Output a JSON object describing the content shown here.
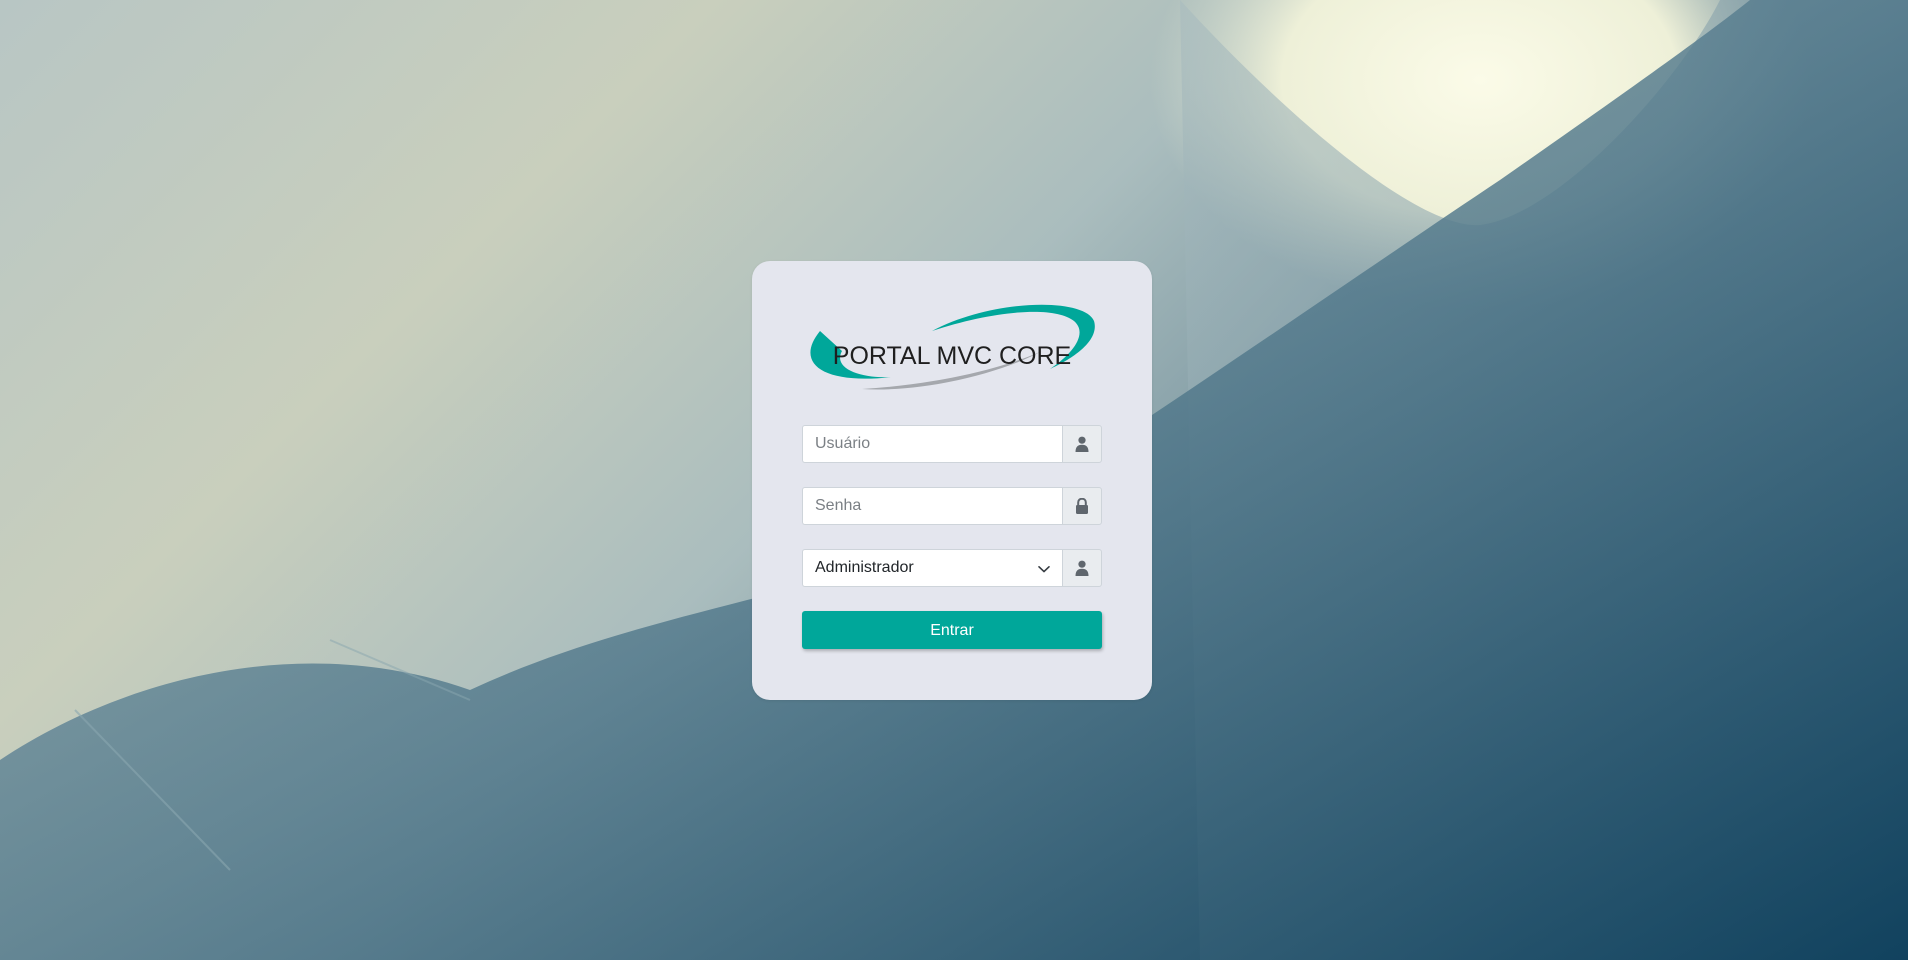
{
  "brand": {
    "logo_text": "PORTAL MVC CORE",
    "accent": "#00a79a"
  },
  "form": {
    "username": {
      "value": "",
      "placeholder": "Usuário",
      "icon": "user-icon"
    },
    "password": {
      "value": "",
      "placeholder": "Senha",
      "icon": "lock-icon"
    },
    "profile": {
      "selected": "Administrador",
      "icon": "user-icon"
    },
    "submit_label": "Entrar"
  }
}
